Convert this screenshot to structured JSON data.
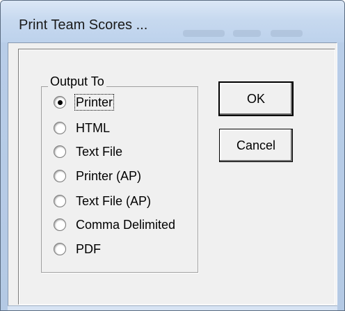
{
  "window": {
    "title": "Print Team Scores ..."
  },
  "output_group": {
    "legend": "Output To",
    "selected": "Printer",
    "options": [
      {
        "label": "Printer",
        "checked": true
      },
      {
        "label": "HTML",
        "checked": false
      },
      {
        "label": "Text File",
        "checked": false
      },
      {
        "label": "Printer (AP)",
        "checked": false
      },
      {
        "label": "Text File (AP)",
        "checked": false
      },
      {
        "label": "Comma Delimited",
        "checked": false
      },
      {
        "label": "PDF",
        "checked": false
      }
    ]
  },
  "buttons": {
    "ok_label": "OK",
    "cancel_label": "Cancel"
  },
  "colors": {
    "title_bar": "#c7d9ef",
    "client_background": "#f0f0f0",
    "text": "#000000"
  }
}
